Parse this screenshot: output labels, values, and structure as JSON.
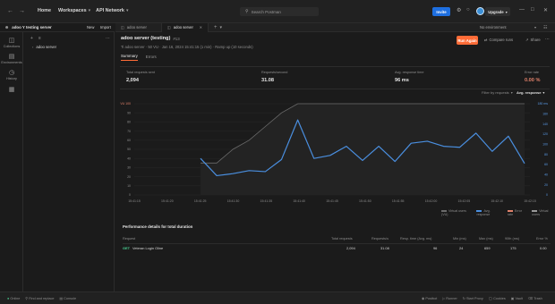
{
  "topbar": {
    "nav_items": [
      "Home",
      "Workspaces",
      "API Network"
    ],
    "search_placeholder": "Search Postman",
    "invite_label": "Invite",
    "upgrade_label": "Upgrade"
  },
  "sidebar": {
    "workspace_name": "adoo Y testing server",
    "new_label": "New",
    "import_label": "Import",
    "rail": [
      {
        "label": "Collections",
        "icon": "collections-icon"
      },
      {
        "label": "Environments",
        "icon": "environments-icon"
      },
      {
        "label": "History",
        "icon": "history-icon"
      },
      {
        "label": "",
        "icon": "grid-icon"
      }
    ],
    "tree_item": "adoo server"
  },
  "tabs": [
    {
      "label": "adoo server",
      "active": false
    },
    {
      "label": "adoo server",
      "active": true
    }
  ],
  "env_label": "No environment",
  "run": {
    "title": "adoo server (testing)",
    "badge": "#13",
    "meta": "Ti adoo server · 50 VU · Jan 16, 2024 15:41:15 (1 min) · Ramp up (10 seconds)",
    "run_again_label": "Run Again",
    "compare_label": "Compare runs",
    "share_label": "Share"
  },
  "subtabs": [
    "Summary",
    "Errors"
  ],
  "stats": [
    {
      "label": "Total requests sent",
      "value": "2,094"
    },
    {
      "label": "Requests/second",
      "value": "31.08"
    },
    {
      "label": "Avg. response time",
      "value": "96 ms"
    },
    {
      "label": "Error rate",
      "value": "0.00 %"
    }
  ],
  "chart_controls": {
    "filter_label": "Filter by requests",
    "metric_label": "Avg. response"
  },
  "chart_data": {
    "type": "line",
    "x": [
      "15:41:15",
      "15:41:18",
      "15:41:21",
      "15:41:24",
      "15:41:27",
      "15:41:30",
      "15:41:33",
      "15:41:36",
      "15:41:39",
      "15:41:42",
      "15:41:45",
      "15:41:48",
      "15:41:51",
      "15:41:54",
      "15:41:57",
      "15:42:00",
      "15:42:03",
      "15:42:06",
      "15:42:09",
      "15:42:12",
      "15:42:15"
    ],
    "x_ticks": [
      "15:41:15",
      "15:41:20",
      "15:41:25",
      "15:41:30",
      "15:41:35",
      "15:41:40",
      "15:41:45",
      "15:41:50",
      "15:41:55",
      "15:42:00",
      "15:42:05",
      "15:42:10",
      "15:42:15"
    ],
    "left_axis": {
      "label": "VU",
      "ticks": [
        "100",
        "90",
        "80",
        "70",
        "60",
        "50",
        "40",
        "30",
        "20",
        "10",
        "0"
      ],
      "ylim": [
        0,
        100
      ]
    },
    "right_axis": {
      "label": "ms",
      "ticks": [
        "180 ms",
        "160",
        "140",
        "120",
        "100",
        "80",
        "60",
        "40",
        "20",
        "0"
      ],
      "ylim": [
        0,
        180
      ]
    },
    "series": [
      {
        "name": "Virtual users (VU)",
        "axis": "left",
        "color": "#6b6b6b",
        "values": [
          35,
          35,
          50,
          60,
          75,
          90,
          100,
          100,
          100,
          100,
          100,
          100,
          100,
          100,
          100,
          100,
          100,
          100,
          100,
          100,
          100
        ]
      },
      {
        "name": "Avg. response",
        "axis": "right",
        "color": "#4a8fe0",
        "values": [
          72,
          38,
          42,
          48,
          46,
          70,
          148,
          72,
          78,
          96,
          68,
          96,
          66,
          102,
          106,
          96,
          94,
          122,
          86,
          116,
          62
        ]
      }
    ],
    "legend": [
      "Virtual users (VU)",
      "Avg. response",
      "Error rate",
      "Virtual users"
    ]
  },
  "details": {
    "title": "Performance details for total duration",
    "columns": [
      "Request",
      "Total requests",
      "Requests/s",
      "Resp. time (Avg. ms)",
      "Min (ms)",
      "Max (ms)",
      "90th (ms)",
      "Error %"
    ],
    "rows": [
      {
        "method": "GET",
        "name": "Veteran Login Oline",
        "total": "2,094",
        "rps": "31.08",
        "avg": "96",
        "min": "24",
        "max": "659",
        "p90": "175",
        "err": "0.00"
      }
    ]
  },
  "statusbar": {
    "left": [
      "Online",
      "Find and replace",
      "Console"
    ],
    "right": [
      "Postbot",
      "Runner",
      "Start Proxy",
      "Cookies",
      "Vault",
      "Trash"
    ]
  }
}
